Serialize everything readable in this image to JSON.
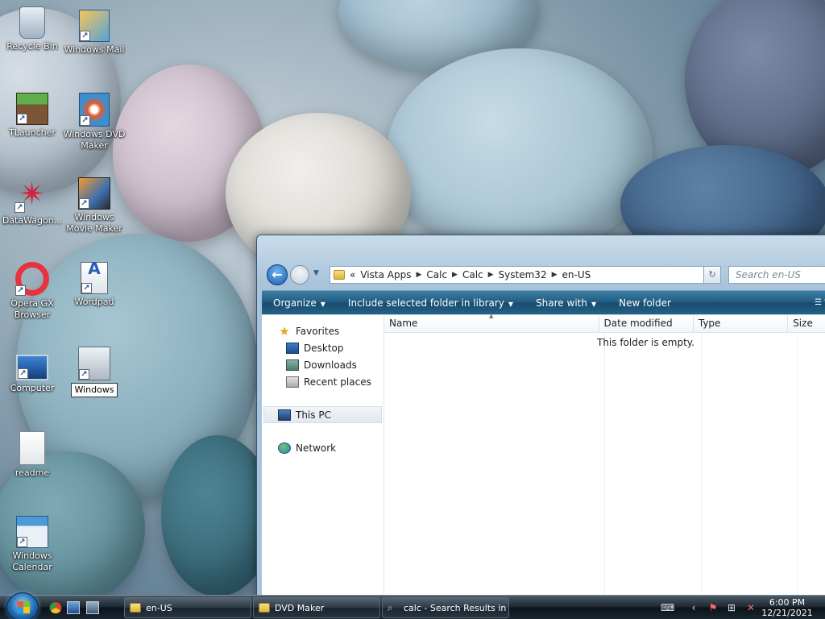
{
  "desktop": {
    "icons": [
      {
        "label": "Recycle Bin",
        "icon": "recycle-bin-icon"
      },
      {
        "label": "Windows Mail",
        "icon": "windows-mail-icon"
      },
      {
        "label": "TLauncher",
        "icon": "tlauncher-icon"
      },
      {
        "label": "Windows DVD Maker",
        "icon": "dvd-maker-icon"
      },
      {
        "label": "DataWagon...",
        "icon": "datawagon-icon"
      },
      {
        "label": "Windows Movie Maker",
        "icon": "movie-maker-icon"
      },
      {
        "label": "Opera GX Browser",
        "icon": "opera-gx-icon"
      },
      {
        "label": "Wordpad",
        "icon": "wordpad-icon"
      },
      {
        "label": "Computer",
        "icon": "computer-icon"
      },
      {
        "label": "Windows",
        "icon": "calculator-icon"
      },
      {
        "label": "readme",
        "icon": "text-document-icon"
      },
      {
        "label": "Windows Calendar",
        "icon": "calendar-icon"
      }
    ]
  },
  "explorer": {
    "address": {
      "overflow": "«",
      "crumbs": [
        "Vista Apps",
        "Calc",
        "Calc",
        "System32",
        "en-US"
      ]
    },
    "search_placeholder": "Search en-US",
    "commands": {
      "organize": "Organize",
      "include": "Include selected folder in library",
      "share": "Share with",
      "new_folder": "New folder"
    },
    "nav": {
      "favorites": "Favorites",
      "desktop": "Desktop",
      "downloads": "Downloads",
      "recent": "Recent places",
      "this_pc": "This PC",
      "network": "Network"
    },
    "columns": {
      "name": "Name",
      "date": "Date modified",
      "type": "Type",
      "size": "Size"
    },
    "empty_message": "This folder is empty."
  },
  "taskbar": {
    "buttons": [
      {
        "label": "en-US"
      },
      {
        "label": "DVD Maker"
      },
      {
        "label": "calc - Search Results in ..."
      }
    ],
    "clock": {
      "time": "6:00 PM",
      "date": "12/21/2021"
    }
  }
}
